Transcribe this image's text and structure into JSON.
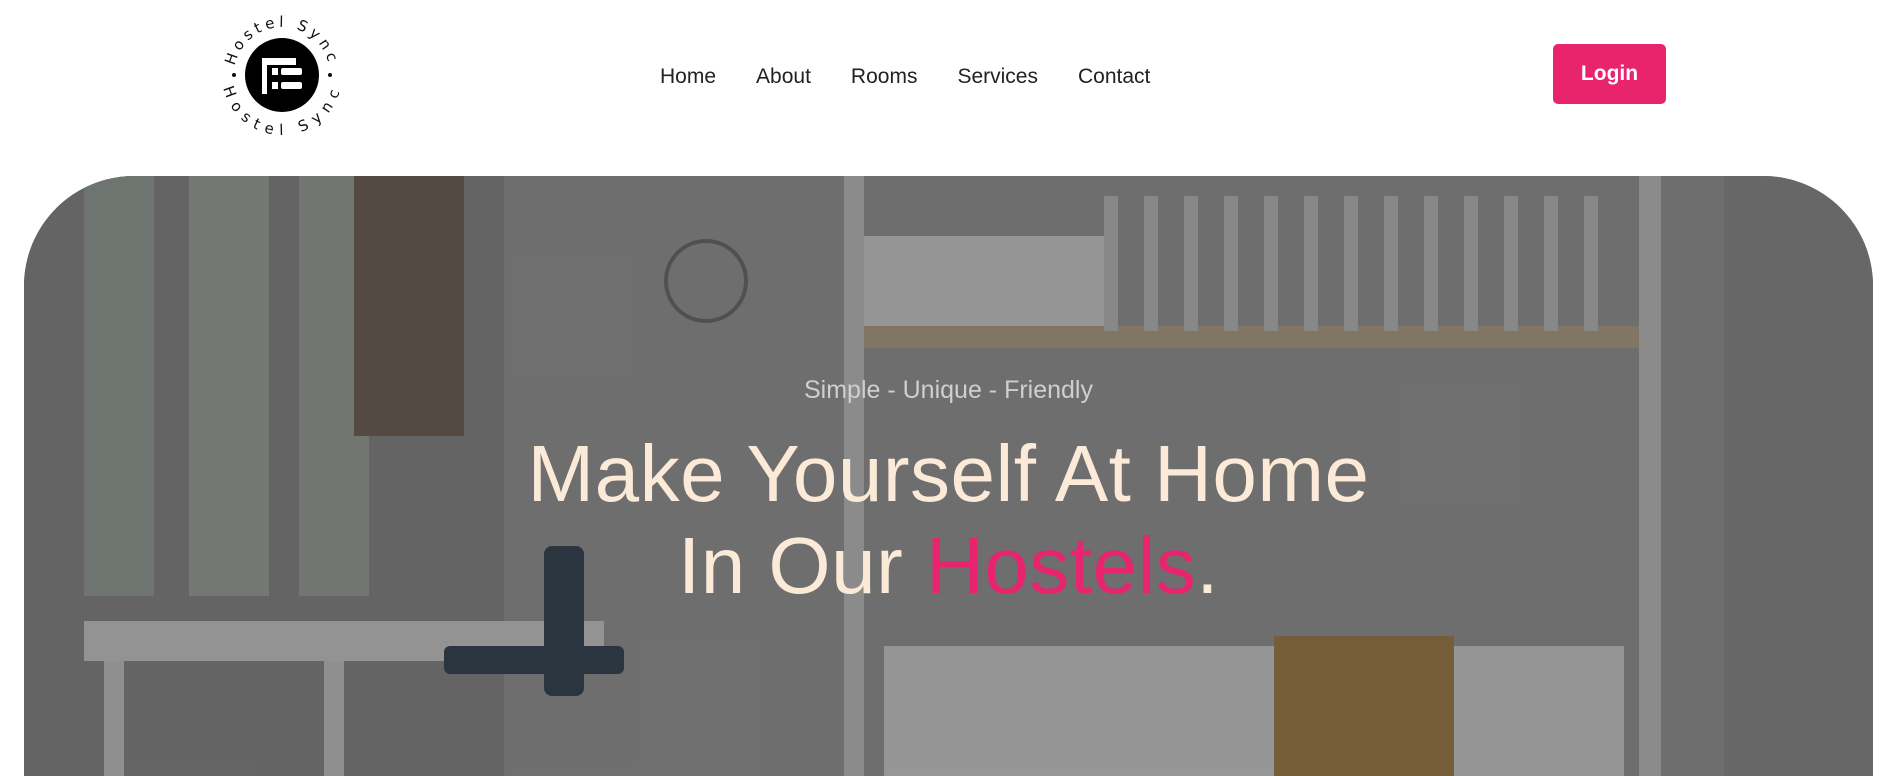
{
  "brand": {
    "logo_text_top": "Hostel Sync",
    "logo_text_bottom": "Hostel Sync",
    "icon": "bunk-bed-icon"
  },
  "nav": {
    "items": [
      {
        "label": "Home"
      },
      {
        "label": "About"
      },
      {
        "label": "Rooms"
      },
      {
        "label": "Services"
      },
      {
        "label": "Contact"
      }
    ]
  },
  "header": {
    "login_label": "Login"
  },
  "hero": {
    "tagline": "Simple - Unique - Friendly",
    "headline_line1": "Make Yourself At Home",
    "headline_line2_prefix": "In Our ",
    "headline_accent": "Hostels",
    "headline_suffix": "."
  },
  "colors": {
    "accent": "#e8246f",
    "headline": "#fbead8",
    "tagline": "#cfcfcf",
    "nav_text": "#222222"
  }
}
